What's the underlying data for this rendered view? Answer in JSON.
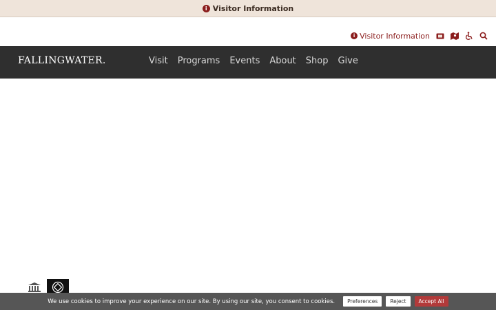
{
  "top_banner": {
    "text": "Visitor Information"
  },
  "utility": {
    "visitor_info": "Visitor Information"
  },
  "brand": {
    "logo_text": "FALLINGWATER."
  },
  "nav": {
    "items": [
      "Visit",
      "Programs",
      "Events",
      "About",
      "Shop",
      "Give"
    ]
  },
  "cookie": {
    "message": "We use cookies to improve your experience on our site. By using our site, you consent to cookies.",
    "preferences": "Preferences",
    "reject": "Reject",
    "accept_all": "Accept All"
  },
  "colors": {
    "accent": "#8b1d1d",
    "nav_bg": "#2f2f2f",
    "banner_bg": "#efe4da"
  },
  "icons": [
    "info-icon",
    "ticket-icon",
    "map-icon",
    "accessibility-icon",
    "search-icon"
  ]
}
